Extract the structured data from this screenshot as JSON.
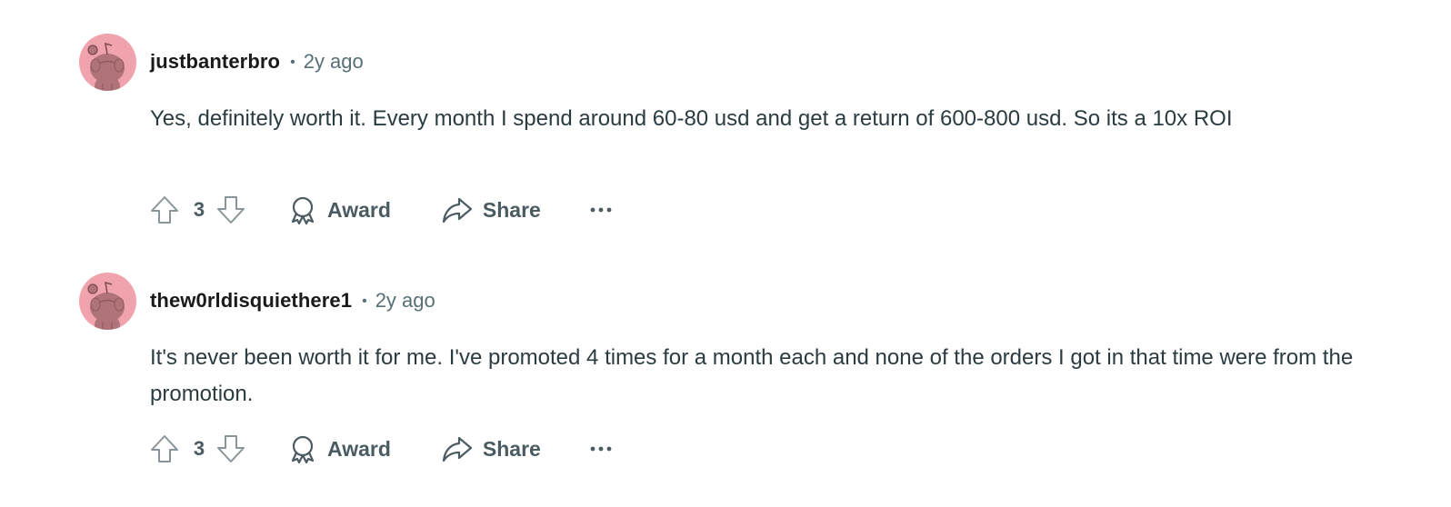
{
  "comments": [
    {
      "username": "justbanterbro",
      "separator": "•",
      "time": "2y ago",
      "body": "Yes, definitely worth it. Every month I spend around 60-80 usd and get a return of 600-800 usd. So its a 10x ROI",
      "votes": "3",
      "award_label": "Award",
      "share_label": "Share",
      "avatar_color": "#f0a3ac"
    },
    {
      "username": "thew0rldisquiethere1",
      "separator": "•",
      "time": "2y ago",
      "body": "It's never been worth it for me. I've promoted 4 times for a month each and none of the orders I got in that time were from the promotion.",
      "votes": "3",
      "award_label": "Award",
      "share_label": "Share",
      "avatar_color": "#f0a3ac"
    }
  ],
  "icons": {
    "upvote": "upvote-arrow-icon",
    "downvote": "downvote-arrow-icon",
    "award": "award-ribbon-icon",
    "share": "share-arrow-icon",
    "more": "more-horizontal-icon"
  },
  "colors": {
    "meta_gray": "#576f76",
    "action_gray": "#4a5b61",
    "body_text": "#2a3c42",
    "avatar_bg": "#f0a3ac",
    "avatar_figure": "#b0737a"
  }
}
